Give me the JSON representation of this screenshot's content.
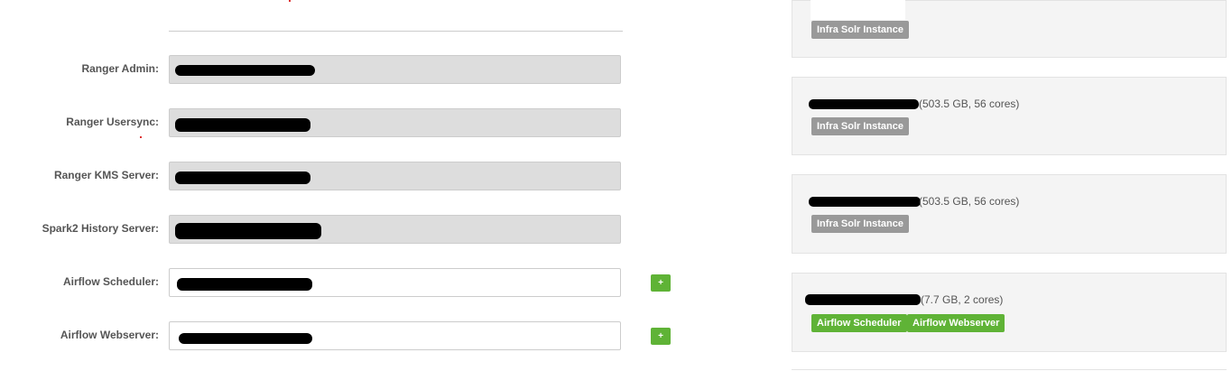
{
  "assignments": [
    {
      "label": "Ranger Admin:",
      "value": "",
      "editable": false
    },
    {
      "label": "Ranger Usersync:",
      "value": "",
      "editable": false
    },
    {
      "label": "Ranger KMS Server:",
      "value": "",
      "editable": false
    },
    {
      "label": "Spark2 History Server:",
      "value": "",
      "editable": false
    },
    {
      "label": "Airflow Scheduler:",
      "value": "",
      "editable": true,
      "add_label": "+"
    },
    {
      "label": "Airflow Webserver:",
      "value": "",
      "editable": true,
      "add_label": "+"
    }
  ],
  "hosts": [
    {
      "name": "",
      "info": "",
      "components": [
        "Infra Solr Instance"
      ]
    },
    {
      "name": "",
      "info": "(503.5 GB, 56 cores)",
      "components": [
        "Infra Solr Instance"
      ]
    },
    {
      "name": "",
      "info": "(503.5 GB, 56 cores)",
      "components": [
        "Infra Solr Instance"
      ]
    },
    {
      "name": "",
      "info": "(7.7 GB, 2 cores)",
      "components": [
        "Airflow Scheduler",
        "Airflow Webserver"
      ]
    }
  ],
  "colors": {
    "green": "#5fb336",
    "grey_badge": "#999999",
    "card_bg": "#f4f4f4"
  }
}
